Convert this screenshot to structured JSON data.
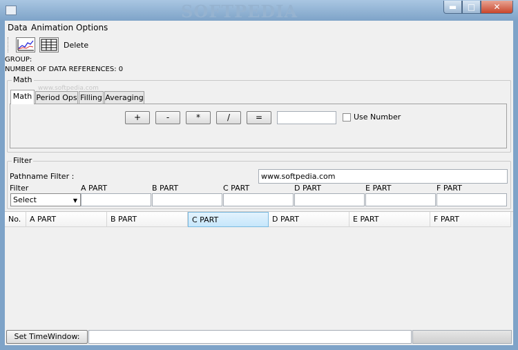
{
  "window": {
    "title_watermark": "SOFTPEDIA",
    "controls": {
      "minimize": "▬",
      "maximize": "□",
      "close": "✕"
    }
  },
  "menu": {
    "items": [
      "Data",
      "Animation",
      "Options"
    ]
  },
  "toolbar": {
    "icons": [
      "line-chart-icon",
      "data-table-icon"
    ],
    "delete_label": "Delete"
  },
  "info": {
    "group_label": "GROUP:",
    "references_label": "NUMBER OF DATA REFERENCES: 0"
  },
  "math": {
    "legend": "Math",
    "tabs": [
      "Math",
      "Period Ops",
      "Filling",
      "Averaging"
    ],
    "active_tab": "Math",
    "operators": [
      "+",
      "-",
      "*",
      "/",
      "="
    ],
    "number_value": "",
    "use_number_label": "Use Number",
    "use_number_checked": false,
    "watermark": "www.softpedia.com"
  },
  "filter": {
    "legend": "Filter",
    "pathname_label": "Pathname Filter :",
    "pathname_value": "www.softpedia.com",
    "filter_label": "Filter",
    "select_value": "Select",
    "parts": [
      "A PART",
      "B PART",
      "C PART",
      "D PART",
      "E PART",
      "F PART"
    ],
    "part_values": [
      "",
      "",
      "",
      "",
      "",
      ""
    ]
  },
  "table": {
    "columns": [
      "No.",
      "A PART",
      "B PART",
      "C PART",
      "D PART",
      "E PART",
      "F PART"
    ],
    "selected_column": "C PART",
    "rows": []
  },
  "status": {
    "time_window_button": "Set TimeWindow:",
    "time_window_value": ""
  },
  "colors": {
    "frame": "#7ea3c8",
    "close_button": "#c9462c",
    "selected_header": "#c6e6fb",
    "panel": "#f0f0f0"
  }
}
